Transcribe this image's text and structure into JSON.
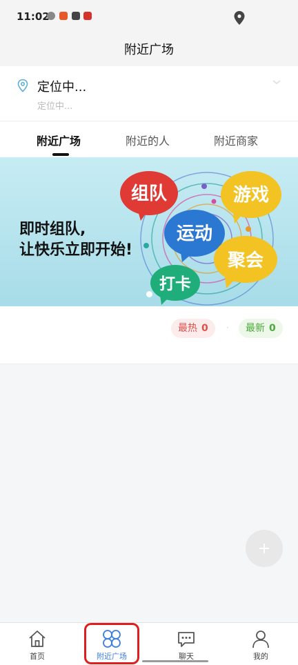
{
  "status_bar": {
    "time": "11:02"
  },
  "header": {
    "title": "附近广场"
  },
  "location": {
    "current": "定位中...",
    "detail": "定位中..."
  },
  "tabs": [
    {
      "label": "附近广场",
      "active": true
    },
    {
      "label": "附近的人",
      "active": false
    },
    {
      "label": "附近商家",
      "active": false
    }
  ],
  "banner": {
    "slogan_line1": "即时组队,",
    "slogan_line2": "让快乐立即开始!",
    "bubbles": [
      "组队",
      "游戏",
      "运动",
      "聚会",
      "打卡"
    ]
  },
  "filters": {
    "hot": {
      "label": "最热",
      "count": "0"
    },
    "new": {
      "label": "最新",
      "count": "0"
    }
  },
  "fab": {
    "icon": "plus-icon"
  },
  "bottom_nav": [
    {
      "label": "首页",
      "icon": "home-icon",
      "active": false
    },
    {
      "label": "附近广场",
      "icon": "square-grid-icon",
      "active": true
    },
    {
      "label": "聊天",
      "icon": "chat-icon",
      "active": false
    },
    {
      "label": "我的",
      "icon": "profile-icon",
      "active": false
    }
  ],
  "colors": {
    "accent": "#3b7de0",
    "hot": "#e0504b",
    "new": "#4aaa3c",
    "highlight": "#e01d1d"
  }
}
